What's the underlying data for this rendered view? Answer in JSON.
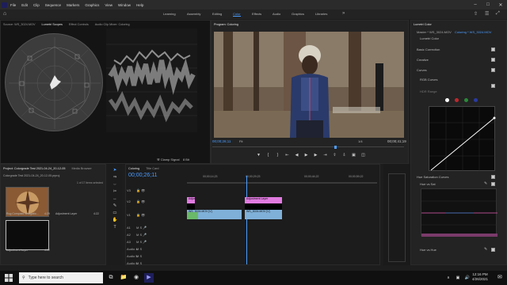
{
  "menu": [
    "File",
    "Edit",
    "Clip",
    "Sequence",
    "Markers",
    "Graphics",
    "View",
    "Window",
    "Help"
  ],
  "workspaces": [
    "Learning",
    "Assembly",
    "Editing",
    "Color",
    "Effects",
    "Audio",
    "Graphics",
    "Libraries"
  ],
  "active_workspace": "Color",
  "source_panel": {
    "tabs": [
      "Source: WS_3024.MOV",
      "Lumetri Scopes",
      "Effect Controls",
      "Audio Clip Mixer: Coloring"
    ],
    "clamp_signal": "Clamp Signal",
    "bit_depth": "8 Bit"
  },
  "program_panel": {
    "title": "Program: Coloring",
    "timecode_current": "00;00;26;11",
    "timecode_duration": "00;00;41;19",
    "fit": "Fit",
    "resolution": "1/4"
  },
  "project_panel": {
    "tabs": [
      "Project: Colorgrade Test 2021-04-24_20-12-05",
      "Media Browser"
    ],
    "project_file": "Colorgrade Test 2021-04-24_20-12-05.prproj",
    "selection": "1 of 17 items selected",
    "bins": [
      {
        "label": "Rug Compass Navigatio...",
        "duration": "4:29"
      },
      {
        "label": "Adjustment Layer",
        "duration": "4:22"
      },
      {
        "label": "Adjustment Layer",
        "duration": "4:22"
      }
    ]
  },
  "timeline": {
    "tabs": [
      "Coloring",
      "Title Card"
    ],
    "timecode": "00;00;26;11",
    "ruler": [
      "00;00;14;23",
      "00;00;29;23",
      "00;00;44;22",
      "00;00;59;22"
    ],
    "tracks": [
      "V3",
      "V2",
      "V1",
      "A1",
      "A2",
      "A3",
      "Audio 4",
      "Audio 5",
      "Audio 6"
    ],
    "clips": [
      {
        "label": "Adjustment Layer",
        "color": "#e07ae0"
      },
      {
        "label": "Adjustment Layer",
        "color": "#e07ae0"
      },
      {
        "label": "WS_3024.MOV [V]",
        "color": "#7fb0d8"
      },
      {
        "label": "WS_3024.MOV [V]",
        "color": "#7fb0d8"
      }
    ]
  },
  "lumetri": {
    "tabs": [
      "Lumetri Color"
    ],
    "master": "Master * WS_3024.MOV",
    "clip": "Coloring * WS_3024.MOV",
    "effect": "Lumetri Color",
    "sections": [
      "Basic Correction",
      "Creative",
      "Curves",
      "RGB Curves",
      "HDR Range",
      "Hue Saturation Curves",
      "Hue vs Sat",
      "Hue vs Hue"
    ]
  },
  "taskbar": {
    "search_placeholder": "Type here to search",
    "time": "12:16 PM",
    "date": "4/26/2021"
  }
}
